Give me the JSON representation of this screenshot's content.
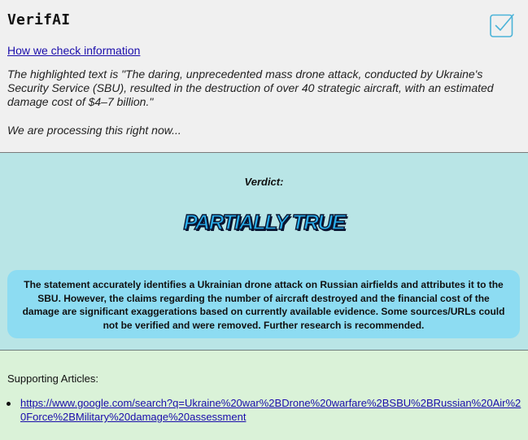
{
  "app": {
    "title": "VerifAI",
    "icon": "checkbox-check-icon",
    "accent_color": "#4bb3d8"
  },
  "header": {
    "how_link": "How we check information",
    "highlighted_text": "The highlighted text is \"The daring, unprecedented mass drone attack, conducted by Ukraine's Security Service (SBU), resulted in the destruction of over 40 strategic aircraft, with an estimated damage cost of $4–7 billion.\"",
    "processing_text": "We are processing this right now..."
  },
  "verdict": {
    "label": "Verdict:",
    "value": "PARTIALLY TRUE",
    "value_color": "#2ab0ee",
    "section_color": "#b9e5e6",
    "summary": "The statement accurately identifies a Ukrainian drone attack on Russian airfields and attributes it to the SBU. However, the claims regarding the number of aircraft destroyed and the financial cost of the damage are significant exaggerations based on currently available evidence. Some sources/URLs could not be verified and were removed. Further research is recommended.",
    "summary_box_color": "#8ddcf2"
  },
  "articles": {
    "label": "Supporting Articles:",
    "section_color": "#daf2d8",
    "items": [
      {
        "url": "https://www.google.com/search?q=Ukraine%20war%2BDrone%20warfare%2BSBU%2BRussian%20Air%20Force%2BMilitary%20damage%20assessment"
      }
    ]
  }
}
